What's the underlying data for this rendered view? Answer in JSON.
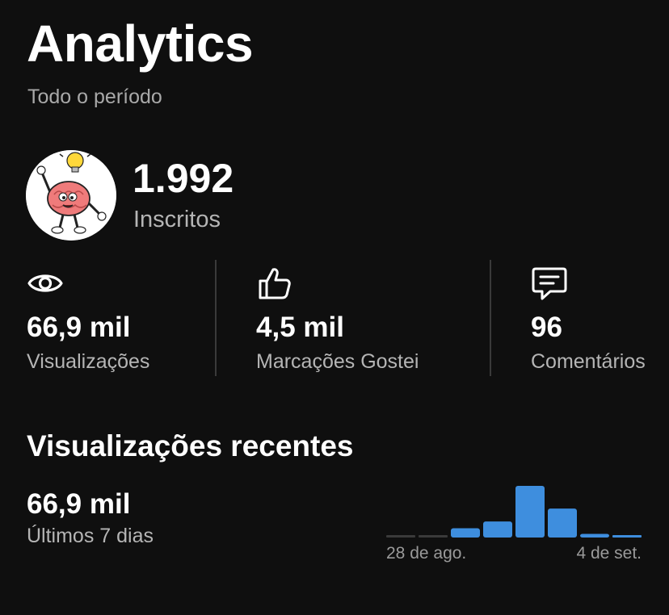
{
  "header": {
    "title": "Analytics",
    "period": "Todo o período"
  },
  "channel": {
    "avatar_icon": "brain-cartoon-lightbulb",
    "subscribers_value": "1.992",
    "subscribers_label": "Inscritos"
  },
  "stats": [
    {
      "icon": "eye-icon",
      "value": "66,9 mil",
      "label": "Visualizações"
    },
    {
      "icon": "thumbs-up-icon",
      "value": "4,5 mil",
      "label": "Marcações Gostei"
    },
    {
      "icon": "comment-icon",
      "value": "96",
      "label": "Comentários"
    }
  ],
  "recent": {
    "title": "Visualizações recentes",
    "value": "66,9 mil",
    "period_label": "Últimos 7 dias"
  },
  "colors": {
    "background": "#0f0f0f",
    "bar_active": "#3e8ede",
    "bar_empty": "#3a3a3a",
    "muted_text": "#a9a9a9"
  },
  "chart_data": {
    "type": "bar",
    "categories": [
      "",
      "",
      "",
      "",
      "",
      "",
      "",
      ""
    ],
    "values": [
      0,
      0,
      0.18,
      0.31,
      1.0,
      0.56,
      0.07,
      0.04
    ],
    "tick_labels": [
      "28 de ago.",
      "4 de set."
    ],
    "title": "",
    "xlabel": "",
    "ylabel": "",
    "grid": false
  }
}
